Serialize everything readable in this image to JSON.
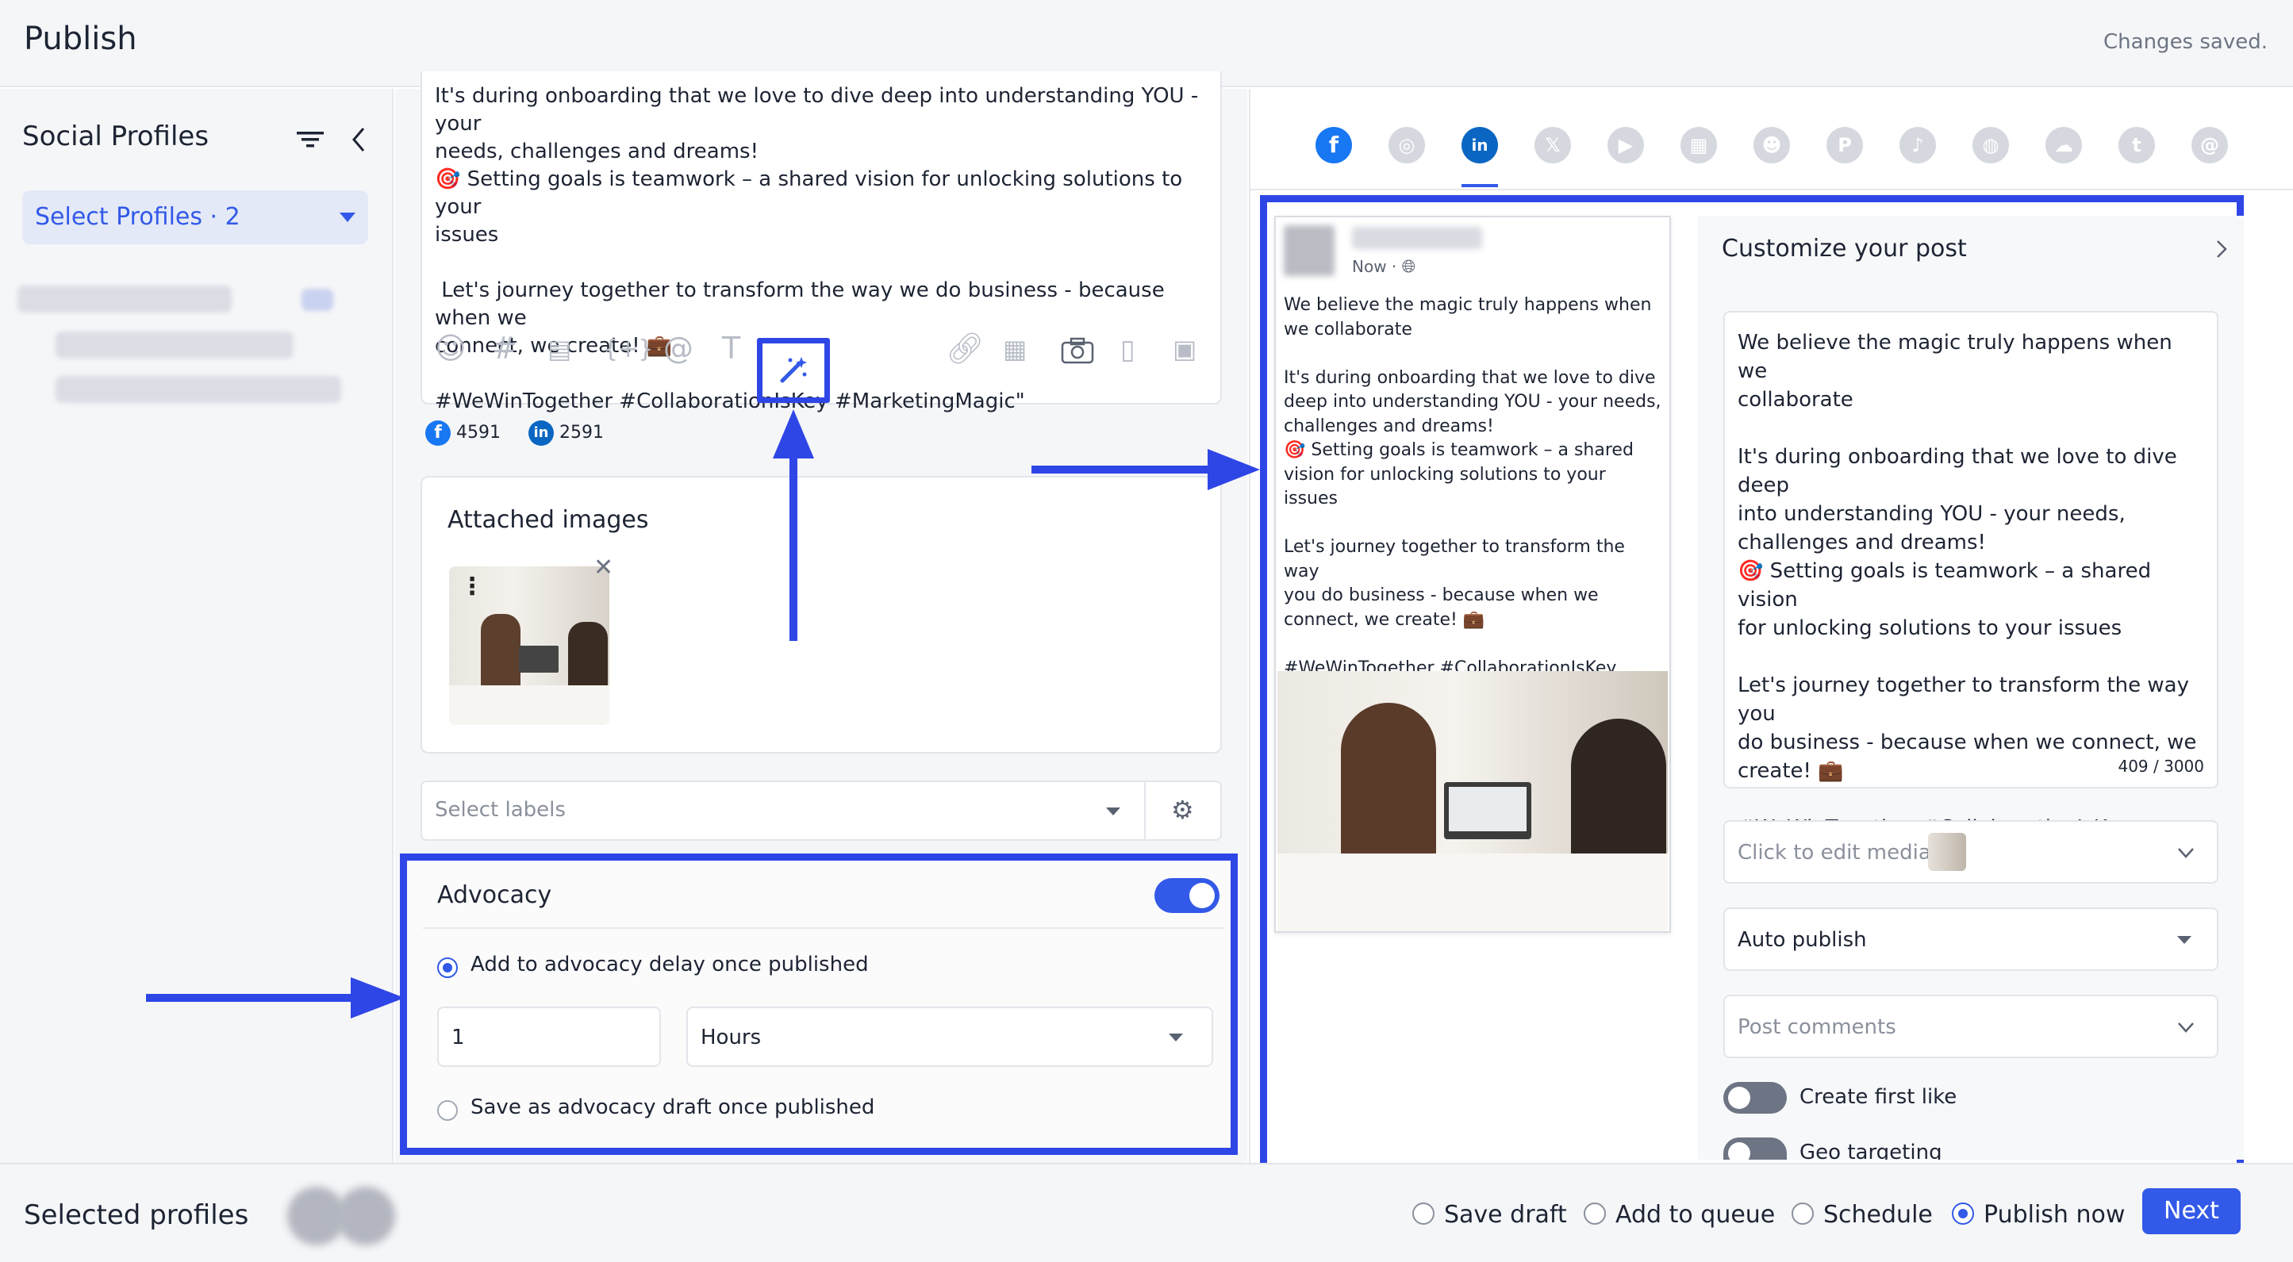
{
  "header": {
    "title": "Publish",
    "status": "Changes saved."
  },
  "sidebar": {
    "title": "Social Profiles",
    "select_label": "Select Profiles · 2",
    "icons": [
      "filter-icon",
      "chevron-left-icon"
    ]
  },
  "editor": {
    "text": "It's during onboarding that we love to dive deep into understanding YOU - your\nneeds, challenges and dreams!\n🎯 Setting goals is teamwork – a shared vision for unlocking solutions to your\nissues\n\n Let's journey together to transform the way we do business - because when we\nconnect, we create! 💼\n\n#WeWinTogether #CollaborationIsKey #MarketingMagic\"",
    "toolbar_icons": [
      "emoji-icon",
      "hashtag-icon",
      "template-icon",
      "variable-icon",
      "mention-icon",
      "text-format-icon",
      "ai-wand-icon",
      "link-icon",
      "media-library-icon",
      "camera-icon",
      "document-icon",
      "gallery-icon"
    ],
    "counts": {
      "facebook": "4591",
      "linkedin": "2591"
    }
  },
  "attached": {
    "title": "Attached images"
  },
  "labels": {
    "placeholder": "Select labels"
  },
  "advocacy": {
    "title": "Advocacy",
    "enabled": true,
    "option_delay": "Add to advocacy delay once published",
    "delay_value": "1",
    "delay_unit": "Hours",
    "option_draft": "Save as advocacy draft once published"
  },
  "networks": [
    "facebook-icon",
    "instagram-icon",
    "linkedin-icon",
    "x-icon",
    "youtube-icon",
    "google-business-icon",
    "reddit-icon",
    "pinterest-icon",
    "tiktok-icon",
    "snapchat-icon",
    "bluesky-icon",
    "tumblr-icon",
    "threads-icon"
  ],
  "preview": {
    "meta": "Now ·",
    "text": "We believe the magic truly happens when\nwe collaborate\n\nIt's during onboarding that we love to dive\ndeep into understanding YOU - your needs,\nchallenges and dreams!\n🎯 Setting goals is teamwork – a shared\nvision for unlocking solutions to your issues\n\nLet's journey together to transform the way\nyou do business - because when we\nconnect, we create! 💼\n\n#WeWinTogether #CollaborationIsKey\n#MarketingMagic\""
  },
  "customize": {
    "title": "Customize your post",
    "text": "We believe the magic truly happens when we\ncollaborate\n\nIt's during onboarding that we love to dive deep\ninto understanding YOU - your needs,\nchallenges and dreams!\n🎯 Setting goals is teamwork – a shared vision\nfor unlocking solutions to your issues\n\nLet's journey together to transform the way you\ndo business - because when we connect, we\ncreate! 💼\n\n#WeWinTogether #CollaborationIsKey\n#MarketingMagic\"",
    "char_count": "409 / 3000",
    "edit_media": "Click to edit media",
    "publish_mode": "Auto publish",
    "post_comments": "Post comments",
    "first_like": "Create first like",
    "geo": "Geo targeting"
  },
  "footer": {
    "title": "Selected profiles",
    "options": [
      "Save draft",
      "Add to queue",
      "Schedule",
      "Publish now"
    ],
    "selected": "Publish now",
    "next": "Next"
  },
  "colors": {
    "accent": "#3259e8",
    "annotation": "#2f46e6",
    "facebook": "#1877f2",
    "linkedin": "#0a66c2"
  }
}
